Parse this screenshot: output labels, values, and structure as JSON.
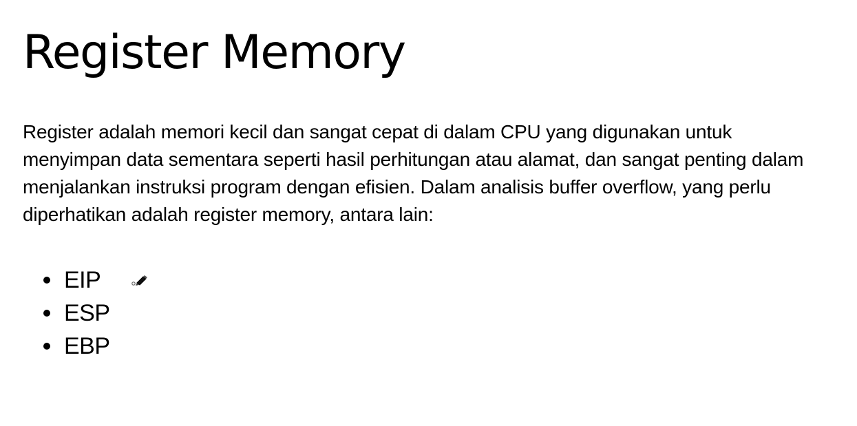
{
  "page": {
    "title": "Register Memory",
    "intro": "Register adalah memori kecil dan sangat cepat di dalam CPU yang digunakan untuk menyimpan data sementara seperti hasil perhitungan atau alamat, dan sangat penting dalam menjalankan instruksi program dengan efisien. Dalam analisis buffer overflow, yang perlu diperhatikan adalah register memory, antara lain:",
    "registers": [
      "EIP",
      "ESP",
      "EBP"
    ]
  },
  "cursor": {
    "icon": "pen-cursor-icon"
  }
}
